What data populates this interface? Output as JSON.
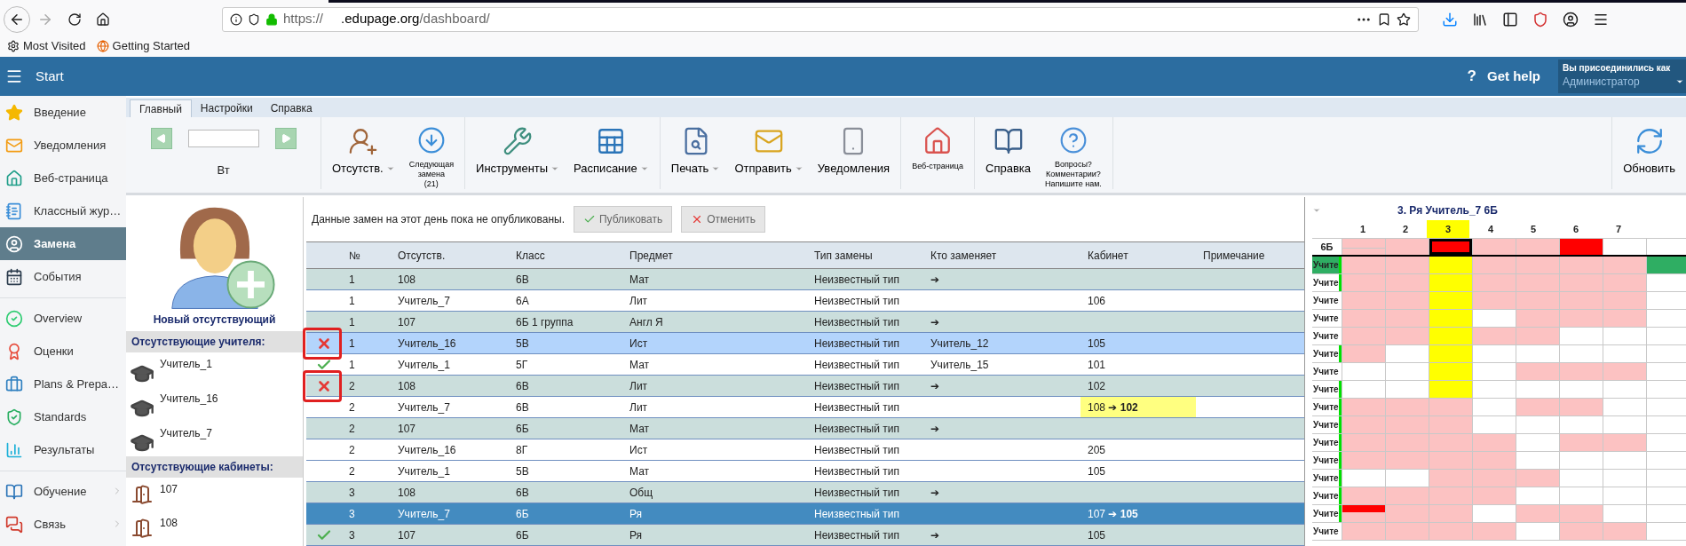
{
  "browser": {
    "url": {
      "scheme": "https://",
      "host": ".edupage.org",
      "path": "/dashboard/"
    },
    "bookmarks": [
      "Most Visited",
      "Getting Started"
    ]
  },
  "header": {
    "menu_label": "Start",
    "help_glyph": "?",
    "help": "Get help",
    "user_caption": "Вы присоединились как",
    "user_role": "Администратор"
  },
  "sidebar": {
    "items": [
      {
        "label": "Введение",
        "selected": false,
        "divider_before": false,
        "submenu": false
      },
      {
        "label": "Уведомления",
        "selected": false,
        "divider_before": false,
        "submenu": false
      },
      {
        "label": "Веб-страница",
        "selected": false,
        "divider_before": false,
        "submenu": false
      },
      {
        "label": "Классный жур…",
        "selected": false,
        "divider_before": false,
        "submenu": false
      },
      {
        "label": "Замена",
        "selected": true,
        "divider_before": false,
        "submenu": false
      },
      {
        "label": "События",
        "selected": false,
        "divider_before": false,
        "submenu": false
      },
      {
        "label": "Overview",
        "selected": false,
        "divider_before": true,
        "submenu": false
      },
      {
        "label": "Оценки",
        "selected": false,
        "divider_before": false,
        "submenu": false
      },
      {
        "label": "Plans & Prepa…",
        "selected": false,
        "divider_before": false,
        "submenu": false
      },
      {
        "label": "Standards",
        "selected": false,
        "divider_before": false,
        "submenu": false
      },
      {
        "label": "Результаты",
        "selected": false,
        "divider_before": false,
        "submenu": false
      },
      {
        "label": "Обучение",
        "selected": false,
        "divider_before": true,
        "submenu": true
      },
      {
        "label": "Связь",
        "selected": false,
        "divider_before": false,
        "submenu": true
      }
    ]
  },
  "ribbon": {
    "tabs": [
      {
        "label": "Главный",
        "selected": true
      },
      {
        "label": "Настройки",
        "selected": false
      },
      {
        "label": "Справка",
        "selected": false
      }
    ],
    "day": "Вт",
    "groups": [
      [
        {
          "label": "Отсутств.",
          "dropdown": true
        },
        {
          "label": "Следующая\nзамена\n(21)",
          "dropdown": false
        }
      ],
      [
        {
          "label": "Инструменты",
          "dropdown": true
        },
        {
          "label": "Расписание",
          "dropdown": true
        }
      ],
      [
        {
          "label": "Печать",
          "dropdown": true
        },
        {
          "label": "Отправить",
          "dropdown": true
        },
        {
          "label": "Уведомления",
          "dropdown": false
        }
      ],
      [
        {
          "label": "Веб-страница",
          "dropdown": false
        }
      ],
      [
        {
          "label": "Справка",
          "dropdown": false
        },
        {
          "label": "Вопросы?\nКомментарии?\nНапишите нам.",
          "dropdown": false
        }
      ],
      [
        {
          "label": "Обновить",
          "dropdown": false
        }
      ]
    ]
  },
  "absences": {
    "new_absent": "Новый отсутствующий",
    "teachers_title": "Отсутствующие учителя:",
    "teachers": [
      "Учитель_1",
      "Учитель_16",
      "Учитель_7"
    ],
    "rooms_title": "Отсутствующие кабинеты:",
    "rooms": [
      "107",
      "108"
    ]
  },
  "substitutions": {
    "notice": "Данные замен на этот день пока не опубликованы.",
    "publish": "Публиковать",
    "cancel": "Отменить",
    "columns": [
      "№",
      "Отсутств.",
      "Класс",
      "Предмет",
      "Тип замены",
      "Кто заменяет",
      "Кабинет",
      "Примечание"
    ],
    "rows": [
      {
        "rejected": false,
        "accepted": false,
        "annotated": false,
        "kind": "room",
        "selected": false,
        "hovered": false,
        "number": "1",
        "absent": "108",
        "class": "6В",
        "subject": "Мат",
        "type": "Неизвестный тип",
        "substitute": "➔"
      },
      {
        "rejected": false,
        "accepted": false,
        "annotated": false,
        "kind": "teacher",
        "selected": false,
        "hovered": false,
        "room_changed": false,
        "number": "1",
        "absent": "Учитель_7",
        "class": "6А",
        "subject": "Лит",
        "type": "Неизвестный тип",
        "room": "106"
      },
      {
        "rejected": false,
        "accepted": false,
        "annotated": false,
        "kind": "room",
        "selected": false,
        "hovered": false,
        "number": "1",
        "absent": "107",
        "class": "6Б 1 группа",
        "subject": "Англ Я",
        "type": "Неизвестный тип",
        "substitute": "➔"
      },
      {
        "rejected": true,
        "accepted": false,
        "annotated": true,
        "kind": "teacher",
        "selected": false,
        "hovered": true,
        "room_changed": false,
        "number": "1",
        "absent": "Учитель_16",
        "class": "5В",
        "subject": "Ист",
        "type": "Неизвестный тип",
        "substitute": "Учитель_12",
        "room": "105"
      },
      {
        "rejected": false,
        "accepted": true,
        "annotated": false,
        "kind": "teacher",
        "selected": false,
        "hovered": false,
        "room_changed": false,
        "number": "1",
        "absent": "Учитель_1",
        "class": "5Г",
        "subject": "Мат",
        "type": "Неизвестный тип",
        "substitute": "Учитель_15",
        "room": "101"
      },
      {
        "rejected": true,
        "accepted": false,
        "annotated": true,
        "kind": "room",
        "selected": false,
        "hovered": false,
        "room_changed": false,
        "number": "2",
        "absent": "108",
        "class": "6В",
        "subject": "Лит",
        "type": "Неизвестный тип",
        "substitute": "➔",
        "room": "102"
      },
      {
        "rejected": false,
        "accepted": false,
        "annotated": false,
        "kind": "teacher",
        "selected": false,
        "hovered": false,
        "room_changed": true,
        "number": "2",
        "absent": "Учитель_7",
        "class": "6В",
        "subject": "Лит",
        "type": "Неизвестный тип",
        "room": "108 ➔ **102**"
      },
      {
        "rejected": false,
        "accepted": false,
        "annotated": false,
        "kind": "room",
        "selected": false,
        "hovered": false,
        "number": "2",
        "absent": "107",
        "class": "6Б",
        "subject": "Мат",
        "type": "Неизвестный тип",
        "substitute": "➔"
      },
      {
        "rejected": false,
        "accepted": false,
        "annotated": false,
        "kind": "teacher",
        "selected": false,
        "hovered": false,
        "room_changed": false,
        "number": "2",
        "absent": "Учитель_16",
        "class": "8Г",
        "subject": "Ист",
        "type": "Неизвестный тип",
        "room": "205"
      },
      {
        "rejected": false,
        "accepted": false,
        "annotated": false,
        "kind": "teacher",
        "selected": false,
        "hovered": false,
        "room_changed": false,
        "number": "2",
        "absent": "Учитель_1",
        "class": "5В",
        "subject": "Мат",
        "type": "Неизвестный тип",
        "room": "105"
      },
      {
        "rejected": false,
        "accepted": false,
        "annotated": false,
        "kind": "room",
        "selected": false,
        "hovered": false,
        "number": "3",
        "absent": "108",
        "class": "6В",
        "subject": "Общ",
        "type": "Неизвестный тип",
        "substitute": "➔"
      },
      {
        "rejected": false,
        "accepted": false,
        "annotated": false,
        "kind": "teacher",
        "selected": true,
        "hovered": false,
        "room_changed": false,
        "number": "3",
        "absent": "Учитель_7",
        "class": "6Б",
        "subject": "Ря",
        "type": "Неизвестный тип",
        "room": "107 ➔ **105**"
      },
      {
        "rejected": false,
        "accepted": true,
        "annotated": false,
        "kind": "room",
        "selected": false,
        "hovered": false,
        "room_changed": false,
        "number": "3",
        "absent": "107",
        "class": "6Б",
        "subject": "Ря",
        "type": "Неизвестный тип",
        "substitute": "➔",
        "room": "105"
      }
    ]
  },
  "timetable": {
    "title": "3. Ря Учитель_7 6Б",
    "periods": [
      {
        "label": "1",
        "selected": false
      },
      {
        "label": "2",
        "selected": false
      },
      {
        "label": "3",
        "selected": true
      },
      {
        "label": "4",
        "selected": false
      },
      {
        "label": "5",
        "selected": false
      },
      {
        "label": "6",
        "selected": false
      },
      {
        "label": "7",
        "selected": false
      }
    ],
    "class_row": {
      "label": "6Б",
      "cells": [
        {
          "kind": "split"
        },
        {
          "kind": "busy"
        },
        {
          "kind": "focused"
        },
        {
          "kind": "busy"
        },
        {
          "kind": "busy"
        },
        {
          "kind": "conflict"
        },
        {
          "kind": "free"
        },
        {
          "kind": "free"
        }
      ]
    },
    "rows": [
      {
        "label": "Учите",
        "selected": true,
        "flag": true,
        "cells": [
          {
            "kind": "busy"
          },
          {
            "kind": "busy"
          },
          {
            "kind": "current"
          },
          {
            "kind": "busy"
          },
          {
            "kind": "busy"
          },
          {
            "kind": "busy"
          },
          {
            "kind": "busy"
          },
          {
            "kind": "chosen"
          }
        ]
      },
      {
        "label": "Учите",
        "selected": false,
        "flag": true,
        "cells": [
          {
            "kind": "busy"
          },
          {
            "kind": "busy"
          },
          {
            "kind": "current"
          },
          {
            "kind": "busy"
          },
          {
            "kind": "busy"
          },
          {
            "kind": "busy"
          },
          {
            "kind": "busy"
          },
          {
            "kind": "free"
          }
        ]
      },
      {
        "label": "Учите",
        "selected": false,
        "flag": false,
        "cells": [
          {
            "kind": "busy"
          },
          {
            "kind": "busy"
          },
          {
            "kind": "current"
          },
          {
            "kind": "busy"
          },
          {
            "kind": "busy"
          },
          {
            "kind": "busy"
          },
          {
            "kind": "busy"
          },
          {
            "kind": "free"
          }
        ]
      },
      {
        "label": "Учите",
        "selected": false,
        "flag": false,
        "cells": [
          {
            "kind": "busy"
          },
          {
            "kind": "busy"
          },
          {
            "kind": "current"
          },
          {
            "kind": "free"
          },
          {
            "kind": "busy"
          },
          {
            "kind": "busy"
          },
          {
            "kind": "busy"
          },
          {
            "kind": "free"
          }
        ]
      },
      {
        "label": "Учите",
        "selected": false,
        "flag": false,
        "cells": [
          {
            "kind": "busy"
          },
          {
            "kind": "busy"
          },
          {
            "kind": "current"
          },
          {
            "kind": "busy"
          },
          {
            "kind": "busy"
          },
          {
            "kind": "free"
          },
          {
            "kind": "free"
          },
          {
            "kind": "free"
          }
        ]
      },
      {
        "label": "Учите",
        "selected": false,
        "flag": true,
        "cells": [
          {
            "kind": "busy"
          },
          {
            "kind": "free"
          },
          {
            "kind": "current"
          },
          {
            "kind": "free"
          },
          {
            "kind": "free"
          },
          {
            "kind": "free"
          },
          {
            "kind": "free"
          },
          {
            "kind": "free"
          }
        ]
      },
      {
        "label": "Учите",
        "selected": false,
        "flag": false,
        "cells": [
          {
            "kind": "free"
          },
          {
            "kind": "free"
          },
          {
            "kind": "current"
          },
          {
            "kind": "free"
          },
          {
            "kind": "busy"
          },
          {
            "kind": "busy"
          },
          {
            "kind": "busy"
          },
          {
            "kind": "free"
          }
        ]
      },
      {
        "label": "Учите",
        "selected": false,
        "flag": true,
        "cells": [
          {
            "kind": "free"
          },
          {
            "kind": "free"
          },
          {
            "kind": "current"
          },
          {
            "kind": "free"
          },
          {
            "kind": "free"
          },
          {
            "kind": "free"
          },
          {
            "kind": "free"
          },
          {
            "kind": "free"
          }
        ]
      },
      {
        "label": "Учите",
        "selected": false,
        "flag": true,
        "cells": [
          {
            "kind": "busy"
          },
          {
            "kind": "busy"
          },
          {
            "kind": "busy"
          },
          {
            "kind": "free"
          },
          {
            "kind": "busy"
          },
          {
            "kind": "busy"
          },
          {
            "kind": "free"
          },
          {
            "kind": "free"
          }
        ]
      },
      {
        "label": "Учите",
        "selected": false,
        "flag": true,
        "cells": [
          {
            "kind": "busy"
          },
          {
            "kind": "busy"
          },
          {
            "kind": "busy"
          },
          {
            "kind": "free"
          },
          {
            "kind": "free"
          },
          {
            "kind": "free"
          },
          {
            "kind": "free"
          },
          {
            "kind": "free"
          }
        ]
      },
      {
        "label": "Учите",
        "selected": false,
        "flag": true,
        "cells": [
          {
            "kind": "busy"
          },
          {
            "kind": "busy"
          },
          {
            "kind": "busy"
          },
          {
            "kind": "busy"
          },
          {
            "kind": "free"
          },
          {
            "kind": "busy"
          },
          {
            "kind": "busy"
          },
          {
            "kind": "free"
          }
        ]
      },
      {
        "label": "Учите",
        "selected": false,
        "flag": true,
        "cells": [
          {
            "kind": "busy"
          },
          {
            "kind": "busy"
          },
          {
            "kind": "busy"
          },
          {
            "kind": "busy"
          },
          {
            "kind": "free"
          },
          {
            "kind": "free"
          },
          {
            "kind": "free"
          },
          {
            "kind": "free"
          }
        ]
      },
      {
        "label": "Учите",
        "selected": false,
        "flag": true,
        "cells": [
          {
            "kind": "free"
          },
          {
            "kind": "free"
          },
          {
            "kind": "busy"
          },
          {
            "kind": "busy"
          },
          {
            "kind": "busy"
          },
          {
            "kind": "free"
          },
          {
            "kind": "free"
          },
          {
            "kind": "free"
          }
        ]
      },
      {
        "label": "Учите",
        "selected": false,
        "flag": true,
        "cells": [
          {
            "kind": "busy"
          },
          {
            "kind": "busy"
          },
          {
            "kind": "busy"
          },
          {
            "kind": "busy"
          },
          {
            "kind": "free"
          },
          {
            "kind": "free"
          },
          {
            "kind": "free"
          },
          {
            "kind": "free"
          }
        ]
      },
      {
        "label": "Учите",
        "selected": false,
        "flag": true,
        "cells": [
          {
            "kind": "partial"
          },
          {
            "kind": "busy"
          },
          {
            "kind": "busy"
          },
          {
            "kind": "free"
          },
          {
            "kind": "busy"
          },
          {
            "kind": "busy"
          },
          {
            "kind": "free"
          },
          {
            "kind": "free"
          }
        ]
      },
      {
        "label": "Учите",
        "selected": false,
        "flag": false,
        "cells": [
          {
            "kind": "busy"
          },
          {
            "kind": "busy"
          },
          {
            "kind": "busy"
          },
          {
            "kind": "busy"
          },
          {
            "kind": "free"
          },
          {
            "kind": "busy"
          },
          {
            "kind": "busy"
          },
          {
            "kind": "free"
          }
        ]
      }
    ]
  }
}
